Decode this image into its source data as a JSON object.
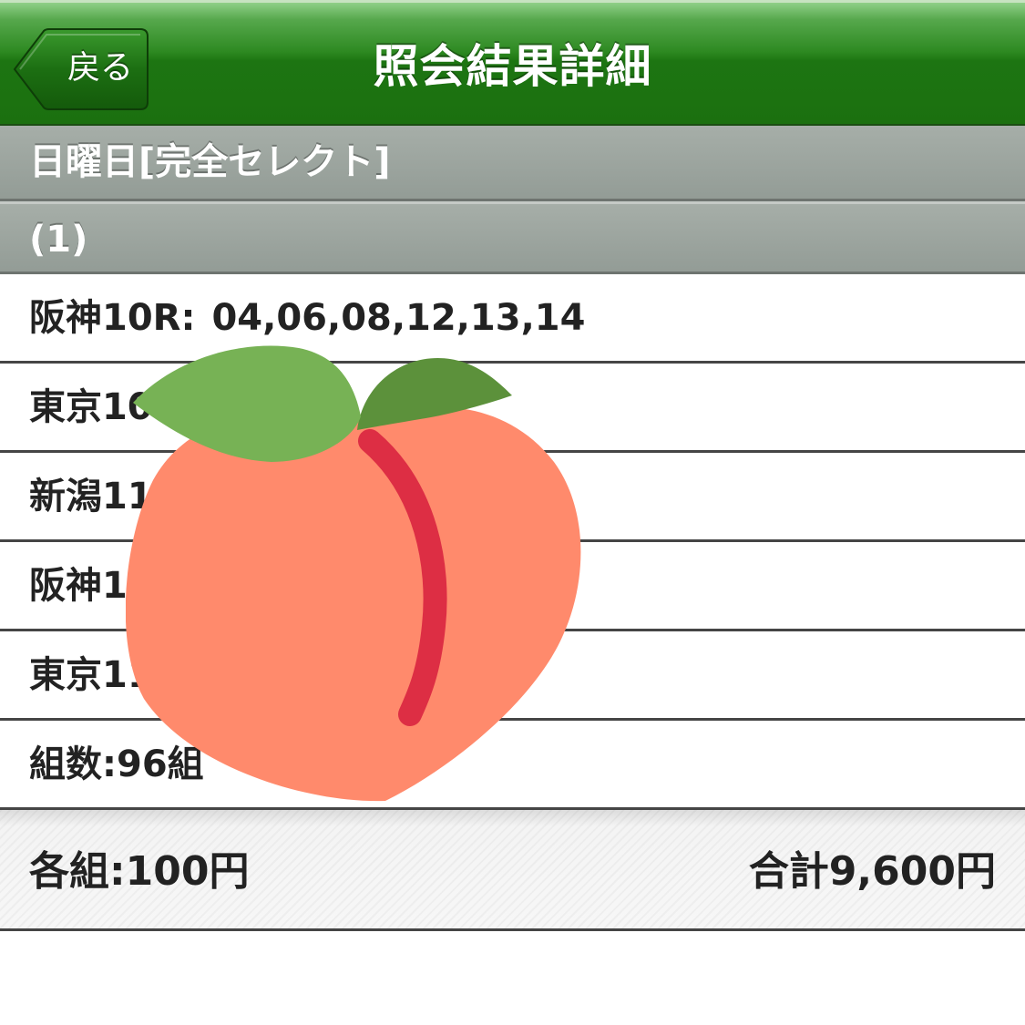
{
  "nav": {
    "back_label": "戻る",
    "title": "照会結果詳細"
  },
  "section": {
    "title": "日曜日[完全セレクト]",
    "subtitle": "(1)"
  },
  "races": [
    {
      "name": "阪神10R:",
      "selections": "04,06,08,12,13,14"
    },
    {
      "name": "東京10",
      "selections": ""
    },
    {
      "name": "新潟11",
      "selections": ""
    },
    {
      "name": "阪神1",
      "selections": ""
    },
    {
      "name": "東京11",
      "selections": ""
    }
  ],
  "combination_count": "組数:96組",
  "footer": {
    "per_combination": "各組:100円",
    "total": "合計9,600円"
  },
  "colors": {
    "nav_green": "#1d7512",
    "section_gray": "#9aa39d",
    "peach_body": "#ff8a6c",
    "peach_crease": "#dd2e44",
    "leaf_light": "#77b255",
    "leaf_dark": "#5c913b"
  },
  "icons": {
    "back": "back-arrow-icon",
    "sticker": "peach-icon"
  }
}
